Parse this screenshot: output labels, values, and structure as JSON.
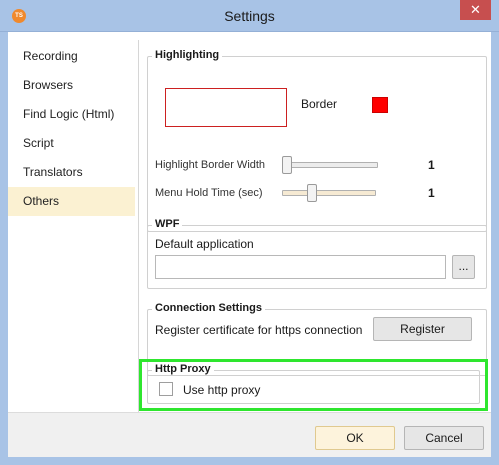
{
  "window": {
    "title": "Settings",
    "app_icon_text": "TS",
    "close_glyph": "✕"
  },
  "sidebar": {
    "items": [
      {
        "label": "Recording"
      },
      {
        "label": "Browsers"
      },
      {
        "label": "Find Logic (Html)"
      },
      {
        "label": "Script"
      },
      {
        "label": "Translators"
      },
      {
        "label": "Others",
        "selected": true
      }
    ]
  },
  "highlighting": {
    "title": "Highlighting",
    "border_label": "Border",
    "border_color": "#ff0000",
    "highlight_border_width": {
      "label": "Highlight Border Width",
      "value": "1"
    },
    "menu_hold_time": {
      "label": "Menu Hold Time (sec)",
      "value": "1"
    }
  },
  "wpf": {
    "title": "WPF",
    "default_app_label": "Default application",
    "default_app_value": "",
    "browse_label": "..."
  },
  "connection": {
    "title": "Connection Settings",
    "register_text": "Register certificate for https connection",
    "register_button": "Register"
  },
  "proxy": {
    "title": "Http Proxy",
    "use_proxy_label": "Use http proxy",
    "use_proxy_checked": false,
    "highlight_color": "#2ee62e"
  },
  "footer": {
    "ok_label": "OK",
    "cancel_label": "Cancel"
  }
}
